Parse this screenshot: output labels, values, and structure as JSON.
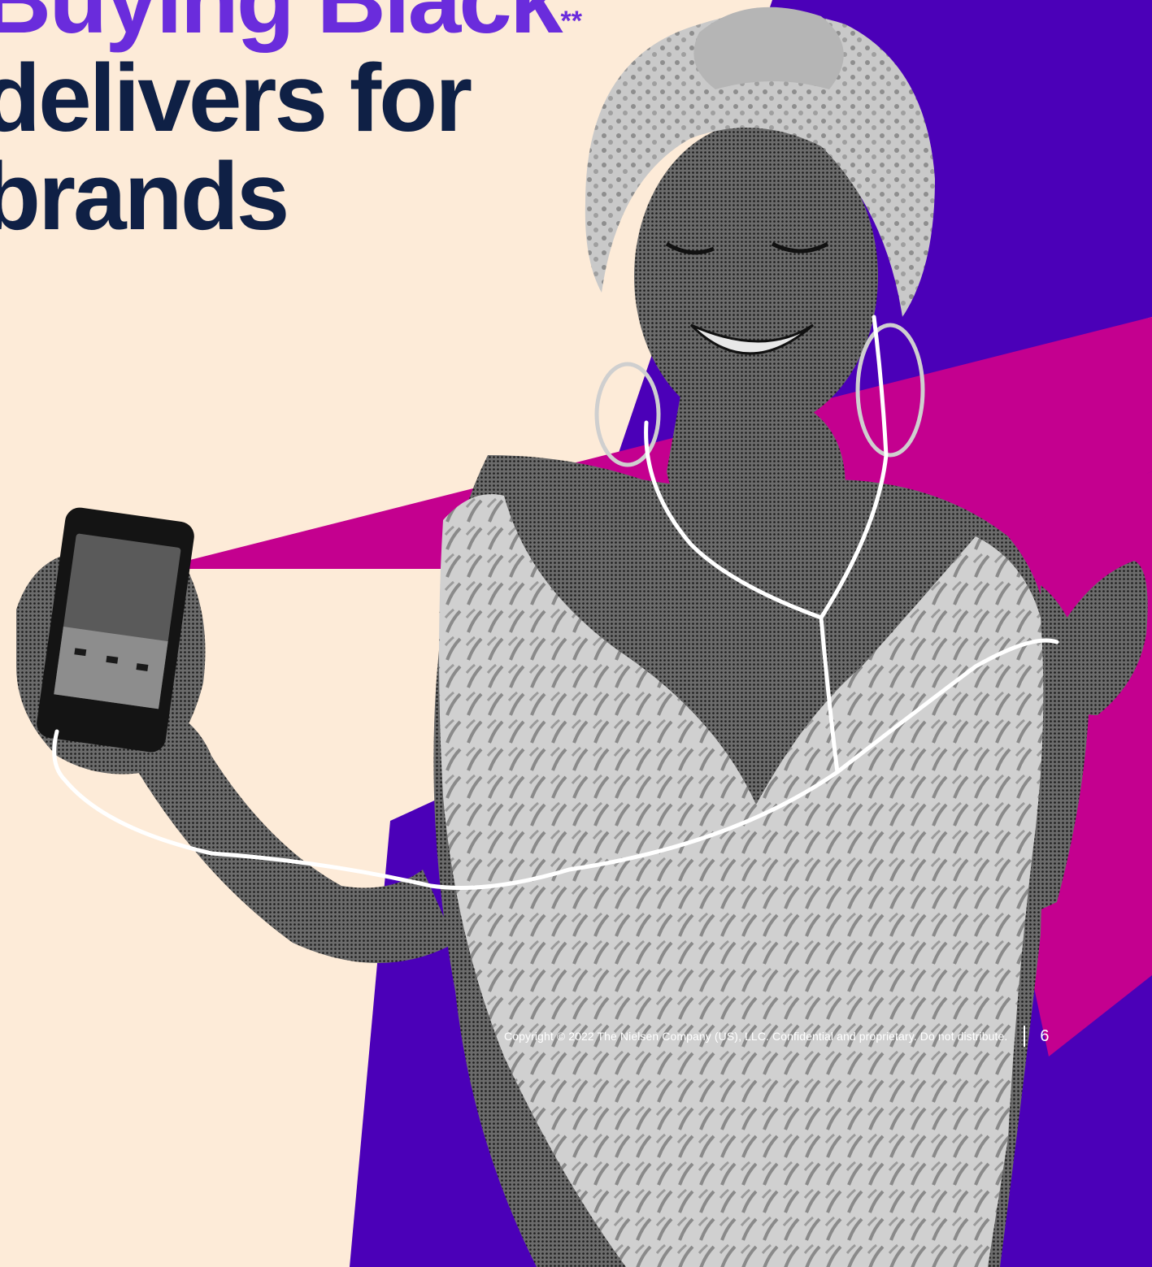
{
  "headline": {
    "accent_line": "Buying Black",
    "accent_mark": "**",
    "line2": "delivers for",
    "line3": "brands"
  },
  "footer": {
    "copyright": "Copyright © 2022 The Nielsen Company (US), LLC. Confidential and proprietary. Do not distribute.",
    "page_number": "6"
  },
  "colors": {
    "background": "#fdebd8",
    "purple": "#4b00b8",
    "magenta": "#c4008f",
    "headline_accent": "#6a2cdc",
    "headline_text": "#0f2045"
  },
  "image": {
    "icon": "person-with-headphones-photo"
  }
}
